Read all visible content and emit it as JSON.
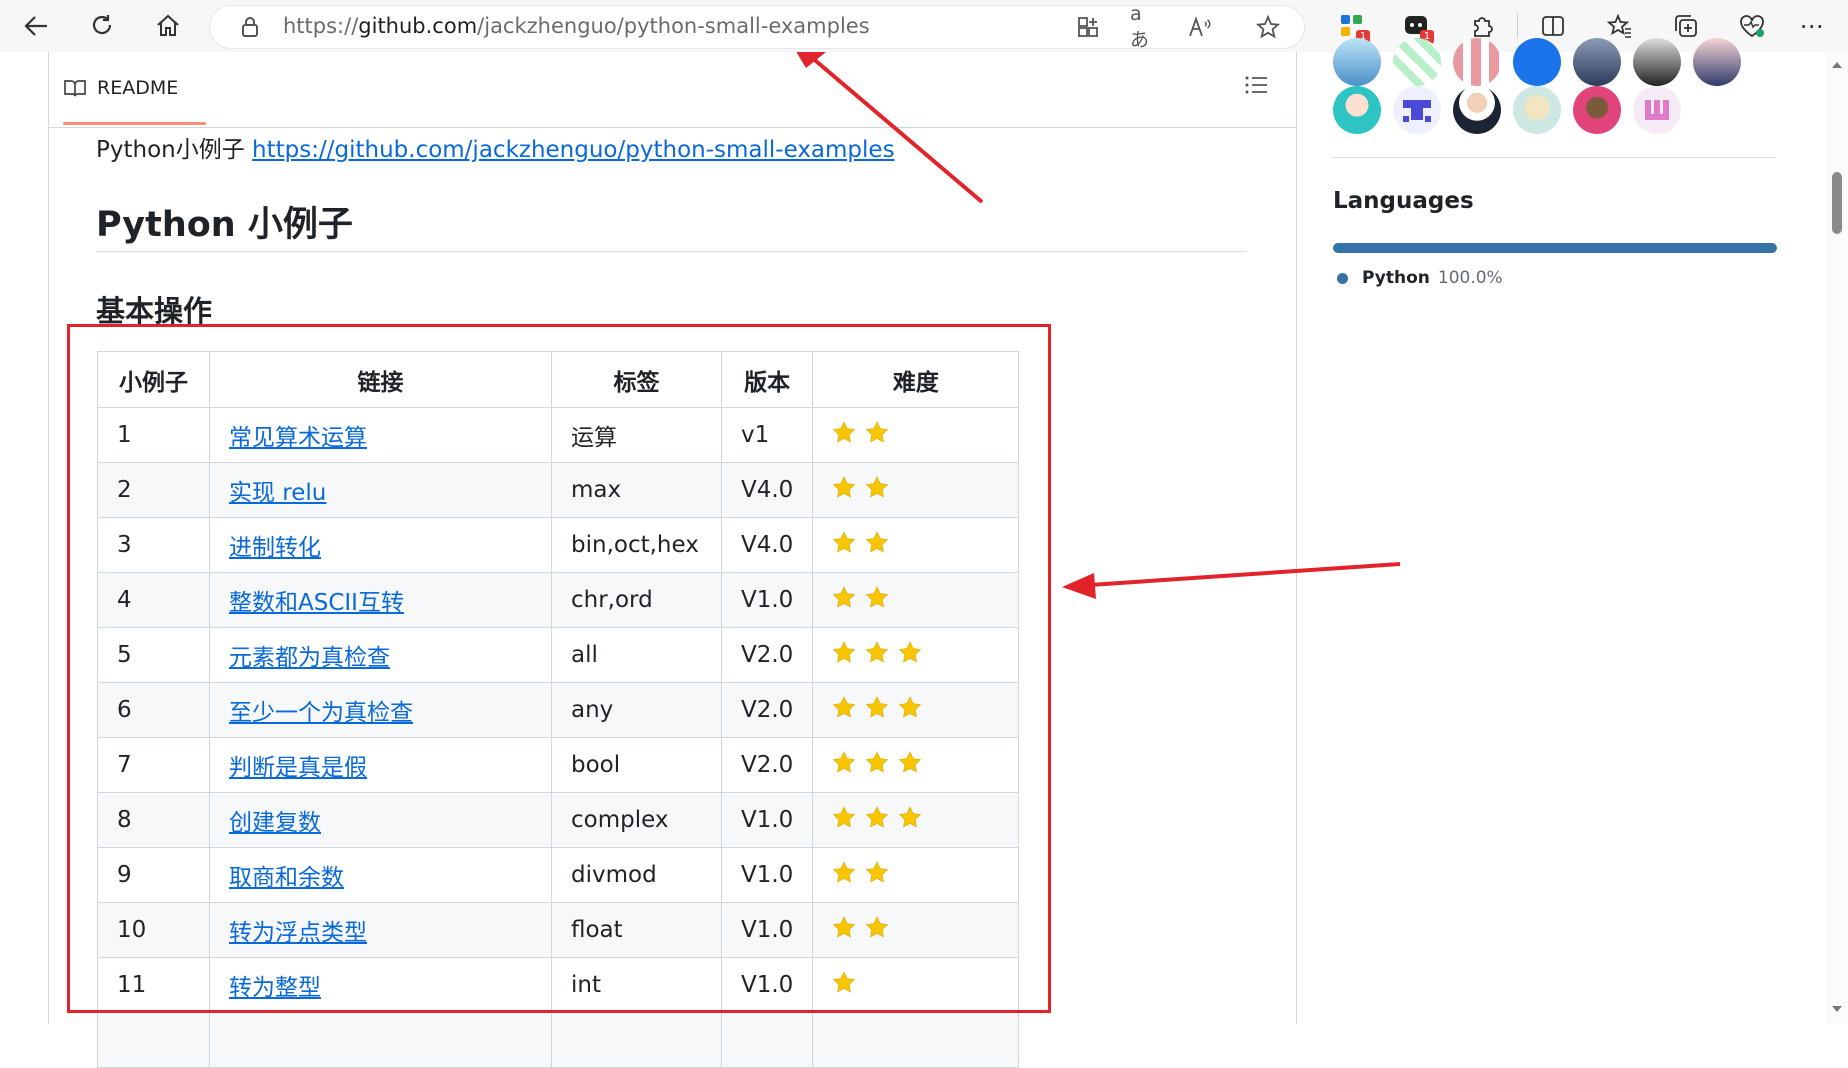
{
  "browser": {
    "url_prefix": "https://",
    "url_host": "github.com",
    "url_path": "/jackzhenguo/python-small-examples",
    "ext_badges": [
      "1",
      "1"
    ]
  },
  "readme": {
    "tab_label": "README",
    "intro_text": "Python小例子 ",
    "intro_link": "https://github.com/jackzhenguo/python-small-examples",
    "title": "Python 小例子",
    "section": "基本操作",
    "columns": [
      "小例子",
      "链接",
      "标签",
      "版本",
      "难度"
    ],
    "rows": [
      {
        "num": "1",
        "link": "常见算术运算",
        "tag": "运算",
        "version": "v1",
        "stars": 2
      },
      {
        "num": "2",
        "link": "实现 relu",
        "tag": "max",
        "version": "V4.0",
        "stars": 2
      },
      {
        "num": "3",
        "link": "进制转化",
        "tag": "bin,oct,hex",
        "version": "V4.0",
        "stars": 2
      },
      {
        "num": "4",
        "link": "整数和ASCII互转",
        "tag": "chr,ord",
        "version": "V1.0",
        "stars": 2
      },
      {
        "num": "5",
        "link": "元素都为真检查",
        "tag": "all",
        "version": "V2.0",
        "stars": 3
      },
      {
        "num": "6",
        "link": "至少一个为真检查",
        "tag": "any",
        "version": "V2.0",
        "stars": 3
      },
      {
        "num": "7",
        "link": "判断是真是假",
        "tag": "bool",
        "version": "V2.0",
        "stars": 3
      },
      {
        "num": "8",
        "link": "创建复数",
        "tag": "complex",
        "version": "V1.0",
        "stars": 3
      },
      {
        "num": "9",
        "link": "取商和余数",
        "tag": "divmod",
        "version": "V1.0",
        "stars": 2
      },
      {
        "num": "10",
        "link": "转为浮点类型",
        "tag": "float",
        "version": "V1.0",
        "stars": 2
      },
      {
        "num": "11",
        "link": "转为整型",
        "tag": "int",
        "version": "V1.0",
        "stars": 1
      },
      {
        "num": "",
        "link": "",
        "tag": "",
        "version": "",
        "stars": 0
      }
    ]
  },
  "sidebar": {
    "languages_title": "Languages",
    "languages": [
      {
        "name": "Python",
        "percent": "100.0%",
        "color": "#3572a5"
      }
    ]
  },
  "colors": {
    "link": "#0969da",
    "star": "#f7c600",
    "annotation": "#e3232a",
    "accent_tab": "#fd8c73"
  }
}
